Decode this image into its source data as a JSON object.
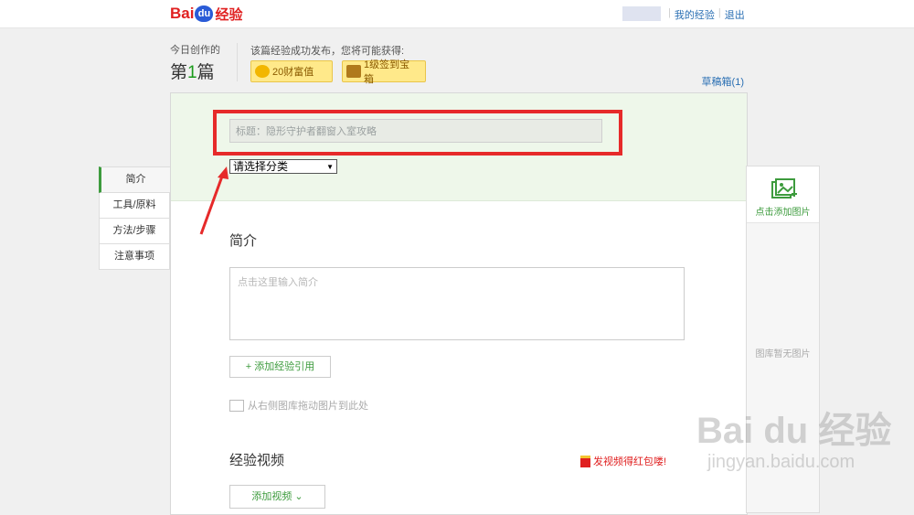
{
  "header": {
    "logo": {
      "bai": "Bai",
      "du": "du",
      "jy": "经验"
    },
    "links": [
      "我的经验",
      "退出"
    ],
    "separator": "|"
  },
  "today": {
    "label": "今日创作的",
    "count_prefix": "第",
    "count": "1",
    "count_suffix": "篇"
  },
  "reward": {
    "text": "该篇经验成功发布，您将可能获得:",
    "badges": [
      {
        "label": "20财富值",
        "icon": "coin-icon"
      },
      {
        "label": "1级签到宝箱",
        "icon": "treasure-chest-icon"
      }
    ]
  },
  "drafts": "草稿箱(1)",
  "sidebar": {
    "items": [
      {
        "label": "简介",
        "active": true
      },
      {
        "label": "工具/原料"
      },
      {
        "label": "方法/步骤"
      },
      {
        "label": "注意事项"
      }
    ]
  },
  "editor": {
    "title_value": "标题：隐形守护者翻窗入室攻略",
    "category": "请选择分类",
    "intro_heading": "简介",
    "intro_placeholder": "点击这里输入简介",
    "add_reference": "+ 添加经验引用",
    "drag_hint": "从右侧图库拖动图片到此处",
    "video_heading": "经验视频",
    "video_promo": "发视频得红包喽!",
    "add_video": "添加视频 ⌄"
  },
  "image_panel": {
    "add_label": "点击添加图片",
    "empty_label": "图库暂无图片"
  },
  "watermark": {
    "line1": "Bai du 经验",
    "line2": "jingyan.baidu.com"
  },
  "colors": {
    "highlight": "#e62a2a",
    "accent_green": "#3d9b3d",
    "link_blue": "#2a6fb3"
  }
}
